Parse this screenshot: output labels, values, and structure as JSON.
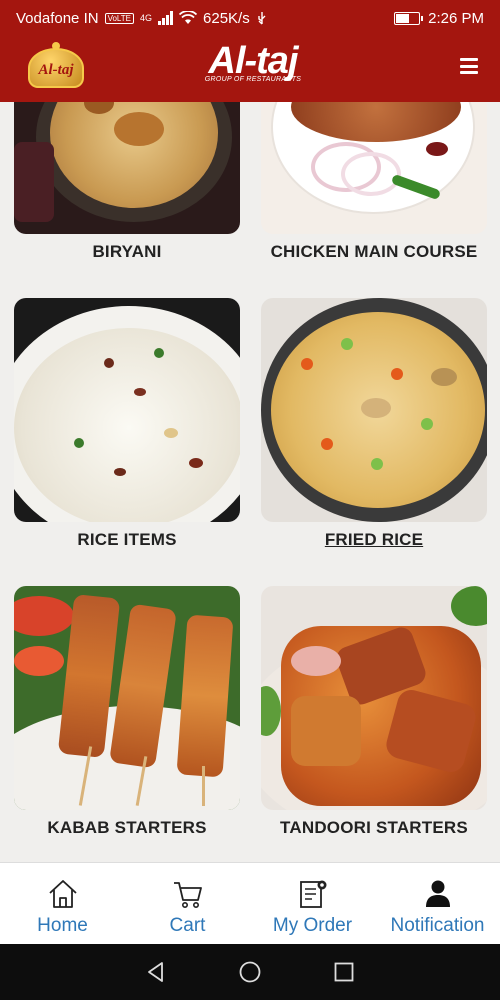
{
  "status_bar": {
    "carrier": "Vodafone IN",
    "volte": "VoLTE",
    "network": "4G",
    "speed": "625K/s",
    "time": "2:26 PM",
    "battery_level": 0.55
  },
  "header": {
    "badge_text": "Al-taj",
    "brand_name": "Al-taj",
    "brand_tagline": "GROUP OF RESTAURANTS",
    "menu_icon": "hamburger-menu-icon"
  },
  "categories": [
    {
      "label": "BIRYANI"
    },
    {
      "label": "CHICKEN MAIN COURSE"
    },
    {
      "label": "RICE ITEMS"
    },
    {
      "label": "FRIED RICE"
    },
    {
      "label": "KABAB STARTERS"
    },
    {
      "label": "TANDOORI STARTERS"
    }
  ],
  "bottom_nav": {
    "home": "Home",
    "cart": "Cart",
    "orders": "My Order",
    "notification": "Notification"
  },
  "colors": {
    "brand_red": "#a4160f",
    "nav_blue": "#2f78b8"
  }
}
